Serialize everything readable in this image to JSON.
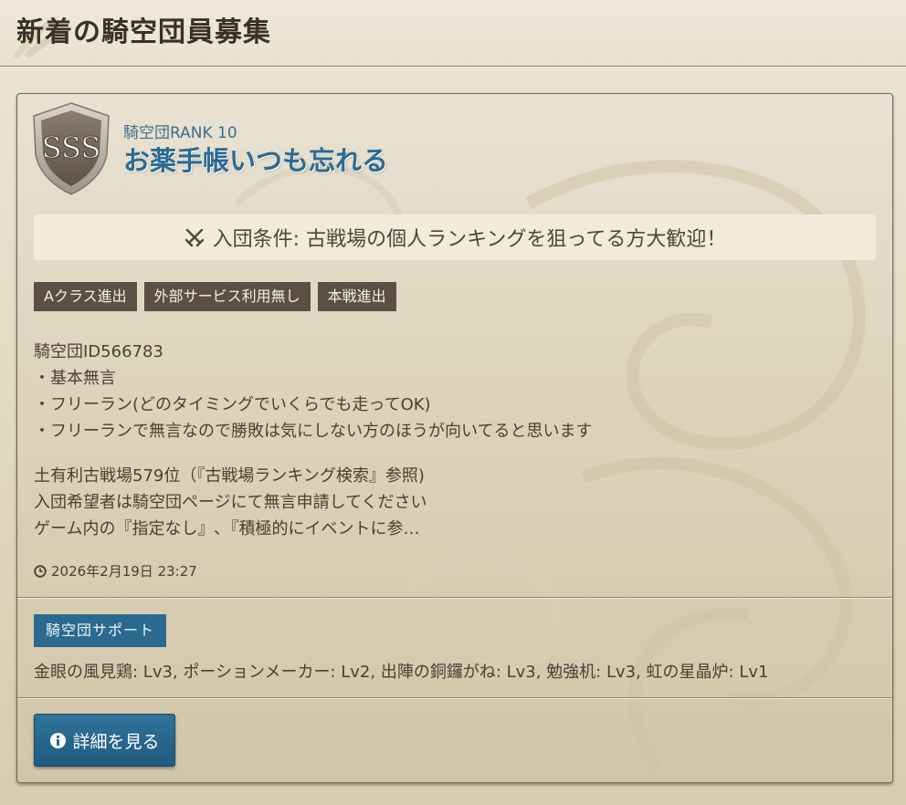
{
  "page": {
    "title": "新着の騎空団員募集"
  },
  "guild": {
    "rank_badge": "SSS",
    "rank_label": "騎空団RANK 10",
    "name": "お薬手帳いつも忘れる",
    "condition": "入団条件: 古戦場の個人ランキングを狙ってる方大歓迎！",
    "tags": [
      "Aクラス進出",
      "外部サービス利用無し",
      "本戦進出"
    ],
    "description_lines": [
      "騎空団ID566783",
      "・基本無言",
      "・フリーラン(どのタイミングでいくらでも走ってOK)",
      "・フリーランで無言なので勝敗は気にしない方のほうが向いてると思います"
    ],
    "description_lines_2": [
      "土有利古戦場579位（『古戦場ランキング検索』参照)",
      "入団希望者は騎空団ページにて無言申請してください",
      "ゲーム内の『指定なし』､『積極的にイベントに参…"
    ],
    "timestamp": "2026年2月19日 23:27",
    "support_label": "騎空団サポート",
    "support_text": "金眼の風見鶏: Lv3, ポーションメーカー: Lv2, 出陣の銅鑼がね: Lv3, 勉強机: Lv3, 虹の星晶炉: Lv1",
    "detail_button": "詳細を見る"
  },
  "icons": {
    "condition": "crossed-swords-icon",
    "timestamp": "clock-icon",
    "detail": "info-circle-icon"
  },
  "colors": {
    "accent_blue": "#2a6a8f",
    "guild_name": "#2c6a91",
    "tag_bg": "#5b5043"
  }
}
